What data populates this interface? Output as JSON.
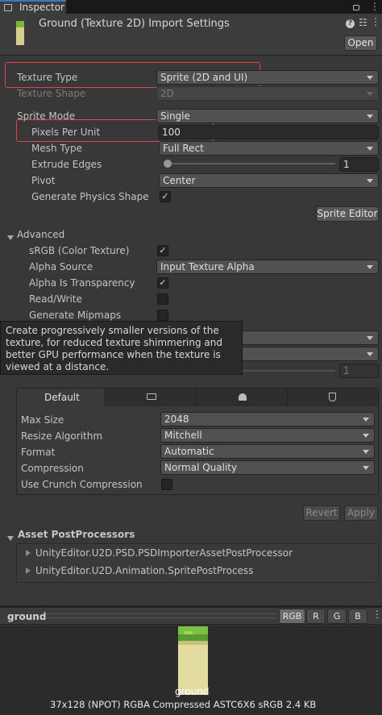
{
  "tab": {
    "title": "Inspector"
  },
  "header": {
    "title": "Ground (Texture 2D) Import Settings",
    "open_label": "Open"
  },
  "main": {
    "texture_type": {
      "label": "Texture Type",
      "value": "Sprite (2D and UI)"
    },
    "texture_shape": {
      "label": "Texture Shape",
      "value": "2D"
    },
    "sprite_mode": {
      "label": "Sprite Mode",
      "value": "Single"
    },
    "pixels_per_unit": {
      "label": "Pixels Per Unit",
      "value": "100"
    },
    "mesh_type": {
      "label": "Mesh Type",
      "value": "Full Rect"
    },
    "extrude_edges": {
      "label": "Extrude Edges",
      "value": "1",
      "slider_fraction": 0.03
    },
    "pivot": {
      "label": "Pivot",
      "value": "Center"
    },
    "generate_physics": {
      "label": "Generate Physics Shape",
      "checked": true
    },
    "sprite_editor_label": "Sprite Editor"
  },
  "advanced": {
    "title": "Advanced",
    "srgb": {
      "label": "sRGB (Color Texture)",
      "checked": true
    },
    "alpha_source": {
      "label": "Alpha Source",
      "value": "Input Texture Alpha"
    },
    "alpha_transparency": {
      "label": "Alpha Is Transparency",
      "checked": true
    },
    "read_write": {
      "label": "Read/Write",
      "checked": false
    },
    "generate_mipmaps": {
      "label": "Generate Mipmaps",
      "checked": false
    },
    "hidden_value": "1",
    "tooltip": "Create progressively smaller versions of the texture, for reduced texture shimmering and better GPU performance when the texture is viewed at a distance."
  },
  "platform": {
    "tabs": {
      "default": "Default"
    },
    "max_size": {
      "label": "Max Size",
      "value": "2048"
    },
    "resize": {
      "label": "Resize Algorithm",
      "value": "Mitchell"
    },
    "format": {
      "label": "Format",
      "value": "Automatic"
    },
    "compression": {
      "label": "Compression",
      "value": "Normal Quality"
    },
    "crunch": {
      "label": "Use Crunch Compression",
      "checked": false
    },
    "revert_label": "Revert",
    "apply_label": "Apply"
  },
  "postprocessors": {
    "title": "Asset PostProcessors",
    "items": [
      "UnityEditor.U2D.PSD.PSDImporterAssetPostProcessor",
      "UnityEditor.U2D.Animation.SpritePostProcess"
    ]
  },
  "preview": {
    "name": "ground",
    "channels": {
      "rgb": "RGB",
      "r": "R",
      "g": "G",
      "b": "B"
    },
    "caption": "ground",
    "info": "37x128 (NPOT)  RGBA Compressed ASTC6X6 sRGB  2.4 KB"
  },
  "colors": {
    "highlight": "#e0444e",
    "background": "#383838"
  }
}
